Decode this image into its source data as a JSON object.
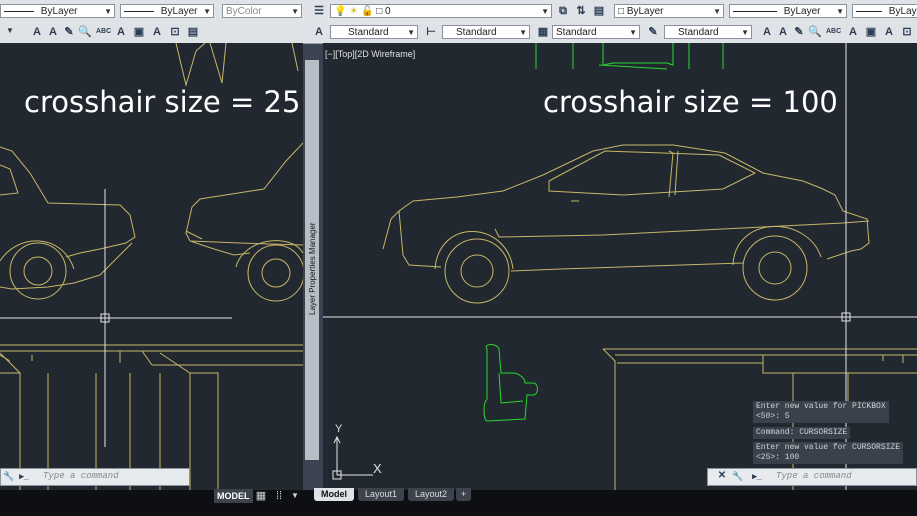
{
  "top_toolbar": {
    "left": {
      "linetype_value": "ByLayer",
      "lineweight_value": "ByLayer",
      "color_value": "ByColor"
    },
    "right": {
      "layer_value": "0",
      "color_value": "ByLayer",
      "linetype_value": "ByLayer",
      "lineweight_value": "ByLayer"
    }
  },
  "style_toolbar": {
    "text_style": "Standard",
    "dim_style": "Standard",
    "table_style": "Standard",
    "multileader_style": "Standard"
  },
  "left_viewport": {
    "caption": "crosshair size = 25"
  },
  "right_viewport": {
    "label": "[−][Top][2D Wireframe]",
    "caption": "crosshair size = 100"
  },
  "layer_properties_manager": {
    "label": "Layer Properties Manager"
  },
  "ucs": {
    "x_label": "X",
    "y_label": "Y"
  },
  "command_line": {
    "placeholder": "Type a command",
    "history": [
      "Enter new value for PICKBOX",
      "<50>: 5",
      "Command: CURSORSIZE",
      "Enter new value for CURSORSIZE",
      "<25>: 100"
    ]
  },
  "status": {
    "model_button": "MODEL"
  },
  "layout_tabs": [
    {
      "label": "Model",
      "active": true
    },
    {
      "label": "Layout1",
      "active": false
    },
    {
      "label": "Layout2",
      "active": false
    },
    {
      "label": "+",
      "active": false
    }
  ],
  "colors": {
    "canvas": "#212830",
    "drawing_line": "#c8b667",
    "chair": "#2bd62b",
    "crosshair": "#e6e6e6"
  }
}
